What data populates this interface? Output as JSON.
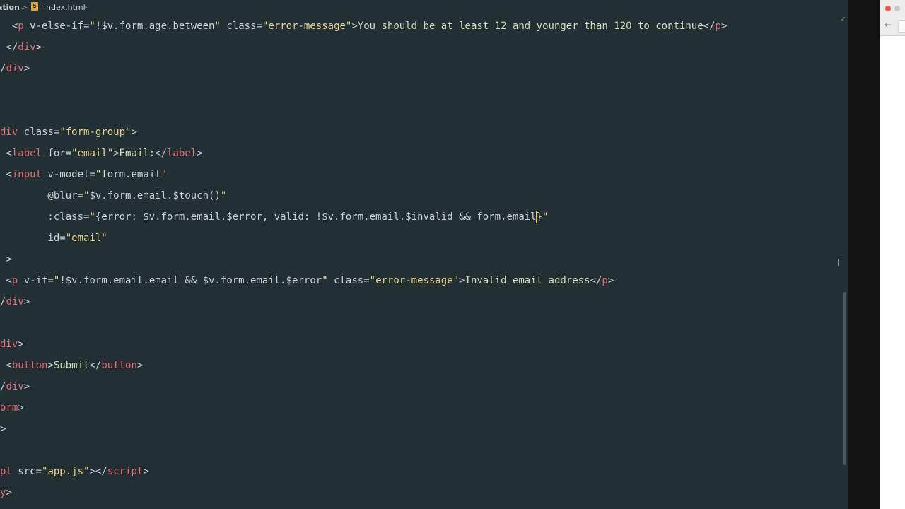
{
  "breadcrumb": {
    "folder": "ation",
    "separator": ">",
    "file_icon": "html5-file-icon",
    "file": "index.html"
  },
  "status": {
    "check_icon": "✓"
  },
  "editor": {
    "lines": [
      {
        "id": "l0",
        "segments": [
          {
            "c": "bracket",
            "t": "  <"
          },
          {
            "c": "tag",
            "t": "p"
          },
          {
            "c": "attr",
            "t": " v-else-if="
          },
          {
            "c": "str",
            "t": "\""
          },
          {
            "c": "kw",
            "t": "!$v.form.age.between"
          },
          {
            "c": "str",
            "t": "\""
          },
          {
            "c": "attr",
            "t": " class="
          },
          {
            "c": "str",
            "t": "\"error-message\""
          },
          {
            "c": "bracket",
            "t": ">"
          },
          {
            "c": "txt",
            "t": "You should be at least 12 and younger than 120 to continue"
          },
          {
            "c": "bracket",
            "t": "</"
          },
          {
            "c": "tag",
            "t": "p"
          },
          {
            "c": "bracket",
            "t": ">"
          }
        ]
      },
      {
        "id": "l1",
        "segments": [
          {
            "c": "bracket",
            "t": " </"
          },
          {
            "c": "tag",
            "t": "div"
          },
          {
            "c": "bracket",
            "t": ">"
          }
        ]
      },
      {
        "id": "l2",
        "segments": [
          {
            "c": "bracket",
            "t": "/"
          },
          {
            "c": "tag",
            "t": "div"
          },
          {
            "c": "bracket",
            "t": ">"
          }
        ]
      },
      {
        "id": "l3",
        "segments": []
      },
      {
        "id": "l4",
        "segments": []
      },
      {
        "id": "l5",
        "segments": [
          {
            "c": "tag",
            "t": "div"
          },
          {
            "c": "attr",
            "t": " class="
          },
          {
            "c": "str",
            "t": "\"form-group\""
          },
          {
            "c": "bracket",
            "t": ">"
          }
        ]
      },
      {
        "id": "l6",
        "segments": [
          {
            "c": "bracket",
            "t": " <"
          },
          {
            "c": "tag",
            "t": "label"
          },
          {
            "c": "attr",
            "t": " for="
          },
          {
            "c": "str",
            "t": "\"email\""
          },
          {
            "c": "bracket",
            "t": ">"
          },
          {
            "c": "txt",
            "t": "Email:"
          },
          {
            "c": "bracket",
            "t": "</"
          },
          {
            "c": "tag",
            "t": "label"
          },
          {
            "c": "bracket",
            "t": ">"
          }
        ]
      },
      {
        "id": "l7",
        "segments": [
          {
            "c": "bracket",
            "t": " <"
          },
          {
            "c": "tag",
            "t": "input"
          },
          {
            "c": "attr",
            "t": " v-model="
          },
          {
            "c": "str",
            "t": "\""
          },
          {
            "c": "kw",
            "t": "form.email"
          },
          {
            "c": "str",
            "t": "\""
          }
        ]
      },
      {
        "id": "l8",
        "segments": [
          {
            "c": "attr",
            "t": "        @blur="
          },
          {
            "c": "str",
            "t": "\""
          },
          {
            "c": "kw",
            "t": "$v.form.email.$touch()"
          },
          {
            "c": "str",
            "t": "\""
          }
        ]
      },
      {
        "id": "l9",
        "segments": [
          {
            "c": "attr",
            "t": "        :class="
          },
          {
            "c": "str",
            "t": "\""
          },
          {
            "c": "kw",
            "t": "{error: $v.form.email.$error, valid: !$v.form.email.$invalid && form.email"
          },
          {
            "c": "cursor",
            "t": ""
          },
          {
            "c": "kw",
            "t": "}"
          },
          {
            "c": "str",
            "t": "\""
          }
        ]
      },
      {
        "id": "l10",
        "segments": [
          {
            "c": "attr",
            "t": "        id="
          },
          {
            "c": "str",
            "t": "\"email\""
          }
        ]
      },
      {
        "id": "l11",
        "segments": [
          {
            "c": "bracket",
            "t": " >"
          }
        ]
      },
      {
        "id": "l12",
        "segments": [
          {
            "c": "bracket",
            "t": " <"
          },
          {
            "c": "tag",
            "t": "p"
          },
          {
            "c": "attr",
            "t": " v-if="
          },
          {
            "c": "str",
            "t": "\""
          },
          {
            "c": "kw",
            "t": "!$v.form.email.email && $v.form.email.$error"
          },
          {
            "c": "str",
            "t": "\""
          },
          {
            "c": "attr",
            "t": " class="
          },
          {
            "c": "str",
            "t": "\"error-message\""
          },
          {
            "c": "bracket",
            "t": ">"
          },
          {
            "c": "txt",
            "t": "Invalid email address"
          },
          {
            "c": "bracket",
            "t": "</"
          },
          {
            "c": "tag",
            "t": "p"
          },
          {
            "c": "bracket",
            "t": ">"
          }
        ]
      },
      {
        "id": "l13",
        "segments": [
          {
            "c": "bracket",
            "t": "/"
          },
          {
            "c": "tag",
            "t": "div"
          },
          {
            "c": "bracket",
            "t": ">"
          }
        ]
      },
      {
        "id": "l14",
        "segments": []
      },
      {
        "id": "l15",
        "segments": [
          {
            "c": "tag",
            "t": "div"
          },
          {
            "c": "bracket",
            "t": ">"
          }
        ]
      },
      {
        "id": "l16",
        "segments": [
          {
            "c": "bracket",
            "t": " <"
          },
          {
            "c": "tag",
            "t": "button"
          },
          {
            "c": "bracket",
            "t": ">"
          },
          {
            "c": "txt",
            "t": "Submit"
          },
          {
            "c": "bracket",
            "t": "</"
          },
          {
            "c": "tag",
            "t": "button"
          },
          {
            "c": "bracket",
            "t": ">"
          }
        ]
      },
      {
        "id": "l17",
        "segments": [
          {
            "c": "bracket",
            "t": "/"
          },
          {
            "c": "tag",
            "t": "div"
          },
          {
            "c": "bracket",
            "t": ">"
          }
        ]
      },
      {
        "id": "l18",
        "segments": [
          {
            "c": "tag",
            "t": "orm"
          },
          {
            "c": "bracket",
            "t": ">"
          }
        ]
      },
      {
        "id": "l19",
        "segments": [
          {
            "c": "bracket",
            "t": ">"
          }
        ]
      },
      {
        "id": "l20",
        "segments": []
      },
      {
        "id": "l21",
        "segments": [
          {
            "c": "tag",
            "t": "pt"
          },
          {
            "c": "attr",
            "t": " src="
          },
          {
            "c": "str",
            "t": "\"app.js\""
          },
          {
            "c": "bracket",
            "t": "></"
          },
          {
            "c": "tag",
            "t": "script"
          },
          {
            "c": "bracket",
            "t": ">"
          }
        ]
      },
      {
        "id": "l22",
        "segments": [
          {
            "c": "tag",
            "t": "y"
          },
          {
            "c": "bracket",
            "t": ">"
          }
        ]
      }
    ]
  },
  "browser": {
    "back_icon": "←",
    "colors": {
      "close": "#ee5a52",
      "minimize": "#c8c8c8",
      "zoom": "#5fb36a"
    }
  }
}
